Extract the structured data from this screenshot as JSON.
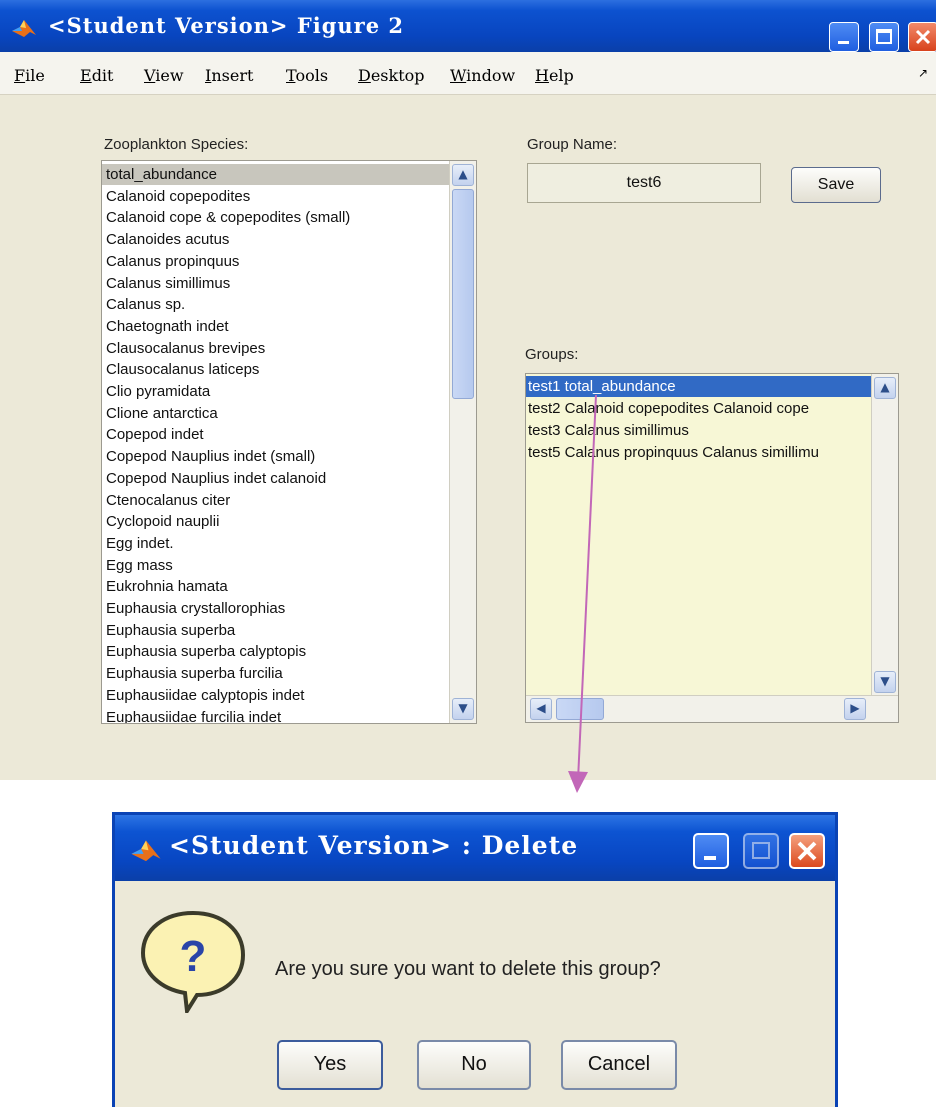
{
  "main_window": {
    "title": "<Student Version> Figure 2",
    "menu": [
      {
        "accel": "F",
        "rest": "ile"
      },
      {
        "accel": "E",
        "rest": "dit"
      },
      {
        "accel": "V",
        "rest": "iew"
      },
      {
        "accel": "I",
        "rest": "nsert"
      },
      {
        "accel": "T",
        "rest": "ools"
      },
      {
        "accel": "D",
        "rest": "esktop"
      },
      {
        "accel": "W",
        "rest": "indow"
      },
      {
        "accel": "H",
        "rest": "elp"
      }
    ],
    "species_label": "Zooplankton Species:",
    "species": [
      "total_abundance",
      "Calanoid copepodites",
      "Calanoid cope & copepodites (small)",
      "Calanoides acutus",
      "Calanus propinquus",
      "Calanus simillimus",
      "Calanus sp.",
      "Chaetognath indet",
      "Clausocalanus brevipes",
      "Clausocalanus laticeps",
      "Clio pyramidata",
      "Clione antarctica",
      "Copepod indet",
      "Copepod Nauplius indet (small)",
      "Copepod Nauplius indet calanoid",
      "Ctenocalanus citer",
      "Cyclopoid nauplii",
      "Egg indet.",
      "Egg mass",
      "Eukrohnia hamata",
      "Euphausia crystallorophias",
      "Euphausia superba",
      "Euphausia superba calyptopis",
      "Euphausia superba furcilia",
      "Euphausiidae calyptopis indet",
      "Euphausiidae furcilia indet"
    ],
    "species_selected_index": 0,
    "group_name_label": "Group Name:",
    "group_name_value": "test6",
    "save_label": "Save",
    "groups_label": "Groups:",
    "groups": [
      "test1 total_abundance",
      "test2 Calanoid copepodites Calanoid cope",
      "test3 Calanus simillimus",
      "test5 Calanus propinquus Calanus simillimu"
    ],
    "groups_selected_index": 0,
    "colors": {
      "titlebar": "#0845bf",
      "groups_bg": "#f7f7d6",
      "selection": "#316ac5",
      "arrow": "#c267b8"
    },
    "icons": {
      "app": "matlab-logo-icon",
      "scroll_up": "chevron-up-icon",
      "scroll_down": "chevron-down-icon",
      "scroll_left": "chevron-left-icon",
      "scroll_right": "chevron-right-icon"
    }
  },
  "dialog": {
    "title": "<Student Version> : Delete",
    "message": "Are you sure you want to delete this group?",
    "buttons": {
      "yes": "Yes",
      "no": "No",
      "cancel": "Cancel"
    },
    "icons": {
      "question": "question-bubble-icon"
    }
  }
}
